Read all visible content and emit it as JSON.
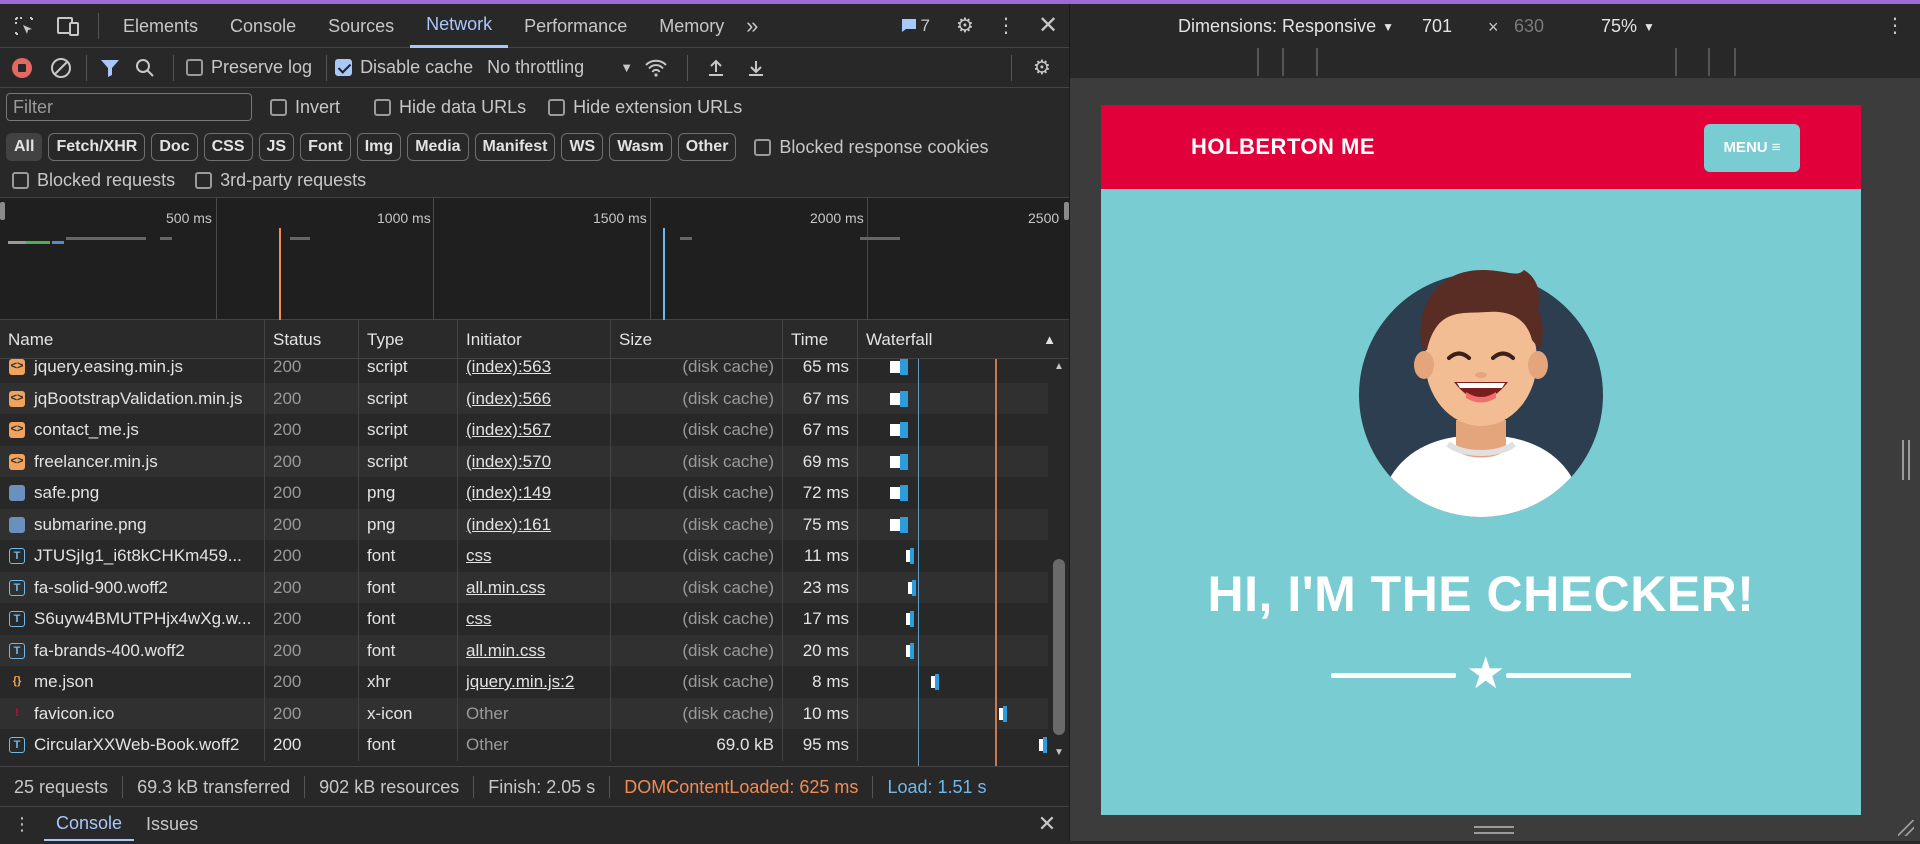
{
  "devtools": {
    "tabs": [
      "Elements",
      "Console",
      "Sources",
      "Network",
      "Performance",
      "Memory"
    ],
    "active_tab": "Network",
    "issues_count": "7",
    "toolbar": {
      "preserve_log": "Preserve log",
      "disable_cache": "Disable cache",
      "throttling": "No throttling"
    },
    "filter": {
      "placeholder": "Filter",
      "invert": "Invert",
      "hide_data_urls": "Hide data URLs",
      "hide_extension_urls": "Hide extension URLs"
    },
    "type_filters": [
      "All",
      "Fetch/XHR",
      "Doc",
      "CSS",
      "JS",
      "Font",
      "Img",
      "Media",
      "Manifest",
      "WS",
      "Wasm",
      "Other"
    ],
    "blocked_response_cookies": "Blocked response cookies",
    "blocked_requests": "Blocked requests",
    "third_party_requests": "3rd-party requests",
    "overview_ticks": [
      "500 ms",
      "1000 ms",
      "1500 ms",
      "2000 ms",
      "2500"
    ],
    "columns": [
      "Name",
      "Status",
      "Type",
      "Initiator",
      "Size",
      "Time",
      "Waterfall"
    ],
    "requests": [
      {
        "name": "jquery.easing.min.js",
        "status": "200",
        "type": "script",
        "initiator": "(index):563",
        "size": "(disk cache)",
        "time": "65 ms",
        "icon": "script-icon"
      },
      {
        "name": "jqBootstrapValidation.min.js",
        "status": "200",
        "type": "script",
        "initiator": "(index):566",
        "size": "(disk cache)",
        "time": "67 ms",
        "icon": "script-icon"
      },
      {
        "name": "contact_me.js",
        "status": "200",
        "type": "script",
        "initiator": "(index):567",
        "size": "(disk cache)",
        "time": "67 ms",
        "icon": "script-icon"
      },
      {
        "name": "freelancer.min.js",
        "status": "200",
        "type": "script",
        "initiator": "(index):570",
        "size": "(disk cache)",
        "time": "69 ms",
        "icon": "script-icon"
      },
      {
        "name": "safe.png",
        "status": "200",
        "type": "png",
        "initiator": "(index):149",
        "size": "(disk cache)",
        "time": "72 ms",
        "icon": "image-icon"
      },
      {
        "name": "submarine.png",
        "status": "200",
        "type": "png",
        "initiator": "(index):161",
        "size": "(disk cache)",
        "time": "75 ms",
        "icon": "image-icon"
      },
      {
        "name": "JTUSjIg1_i6t8kCHKm459...",
        "status": "200",
        "type": "font",
        "initiator": "css",
        "size": "(disk cache)",
        "time": "11 ms",
        "icon": "font-icon"
      },
      {
        "name": "fa-solid-900.woff2",
        "status": "200",
        "type": "font",
        "initiator": "all.min.css",
        "size": "(disk cache)",
        "time": "23 ms",
        "icon": "font-icon"
      },
      {
        "name": "S6uyw4BMUTPHjx4wXg.w...",
        "status": "200",
        "type": "font",
        "initiator": "css",
        "size": "(disk cache)",
        "time": "17 ms",
        "icon": "font-icon"
      },
      {
        "name": "fa-brands-400.woff2",
        "status": "200",
        "type": "font",
        "initiator": "all.min.css",
        "size": "(disk cache)",
        "time": "20 ms",
        "icon": "font-icon"
      },
      {
        "name": "me.json",
        "status": "200",
        "type": "xhr",
        "initiator": "jquery.min.js:2",
        "size": "(disk cache)",
        "time": "8 ms",
        "icon": "json-icon"
      },
      {
        "name": "favicon.ico",
        "status": "200",
        "type": "x-icon",
        "initiator": "Other",
        "size": "(disk cache)",
        "time": "10 ms",
        "icon": "favicon-icon"
      },
      {
        "name": "CircularXXWeb-Book.woff2",
        "status": "200",
        "type": "font",
        "initiator": "Other",
        "size": "69.0 kB",
        "time": "95 ms",
        "icon": "font-icon"
      }
    ],
    "status": {
      "requests": "25 requests",
      "transferred": "69.3 kB transferred",
      "resources": "902 kB resources",
      "finish": "Finish: 2.05 s",
      "dom_content_loaded": "DOMContentLoaded: 625 ms",
      "load": "Load: 1.51 s"
    },
    "drawer_tabs": [
      "Console",
      "Issues"
    ]
  },
  "device": {
    "dimensions": "Dimensions: Responsive",
    "width": "701",
    "height": "630",
    "zoom": "75%",
    "site": {
      "brand": "HOLBERTON ME",
      "menu": "MENU",
      "headline": "HI, I'M THE CHECKER!"
    }
  },
  "colors": {
    "accent": "#a8c7fa",
    "nav_red": "#e1003a",
    "hero_teal": "#79cdd2",
    "dcl_orange": "#f28b54",
    "load_blue": "#6fb9ec"
  }
}
